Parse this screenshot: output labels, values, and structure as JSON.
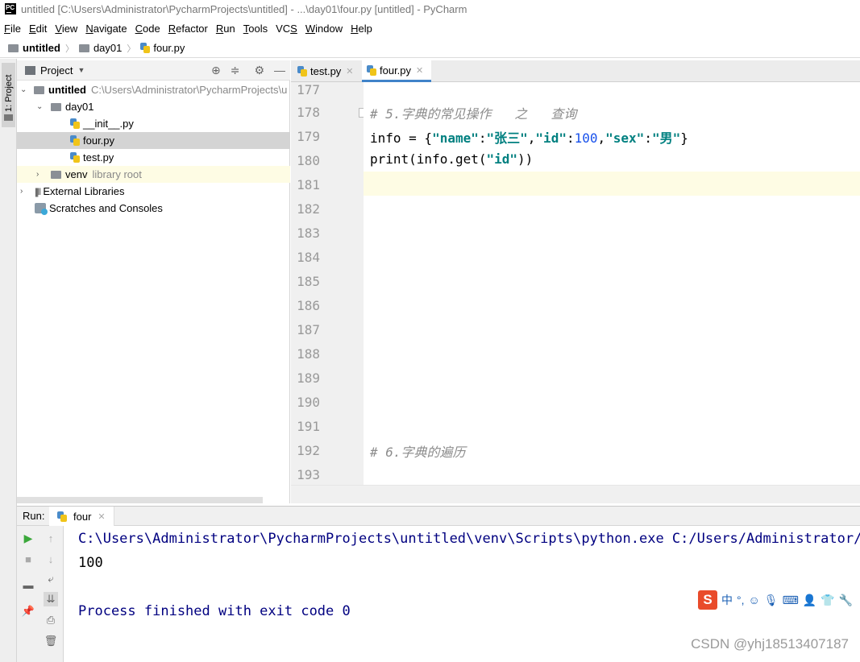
{
  "window": {
    "title": "untitled [C:\\Users\\Administrator\\PycharmProjects\\untitled] - ...\\day01\\four.py [untitled] - PyCharm",
    "app_icon_text": "PC"
  },
  "menu": [
    "File",
    "Edit",
    "View",
    "Navigate",
    "Code",
    "Refactor",
    "Run",
    "Tools",
    "VCS",
    "Window",
    "Help"
  ],
  "breadcrumb": {
    "project": "untitled",
    "folder": "day01",
    "file": "four.py"
  },
  "sidebar": {
    "vertical_tab": "1: Project"
  },
  "project_panel": {
    "title": "Project",
    "tree": {
      "root_name": "untitled",
      "root_path": "C:\\Users\\Administrator\\PycharmProjects\\u",
      "folder": "day01",
      "files": [
        "__init__.py",
        "four.py",
        "test.py"
      ],
      "venv": "venv",
      "venv_note": "library root",
      "external": "External Libraries",
      "scratches": "Scratches and Consoles"
    }
  },
  "editor": {
    "tabs": [
      {
        "label": "test.py"
      },
      {
        "label": "four.py"
      }
    ],
    "active_tab": "four.py",
    "line_numbers": [
      "177",
      "178",
      "179",
      "180",
      "181",
      "182",
      "183",
      "184",
      "185",
      "186",
      "187",
      "188",
      "189",
      "190",
      "191",
      "192",
      "193"
    ],
    "comment1": "# 5.字典的常见操作   之   查询",
    "code_info_var": "info = {",
    "k_name": "\"name\"",
    "v_name": "\"张三\"",
    "k_id": "\"id\"",
    "v_id": "100",
    "k_sex": "\"sex\"",
    "v_sex": "\"男\"",
    "code_print_a": "print(info.get(",
    "code_print_arg": "\"id\"",
    "code_print_b": "))",
    "comment2": "# 6.字典的遍历"
  },
  "run": {
    "label": "Run:",
    "tab": "four",
    "output": [
      "C:\\Users\\Administrator\\PycharmProjects\\untitled\\venv\\Scripts\\python.exe C:/Users/Administrator/Py",
      "100",
      "",
      "Process finished with exit code 0"
    ]
  },
  "ime": {
    "logo": "S",
    "mode": "中",
    "punct": "°,"
  },
  "watermark": "CSDN @yhj18513407187",
  "colors": {
    "output_text": "#000080",
    "current_line": "#fefce4",
    "selection": "#d4d4d4"
  }
}
